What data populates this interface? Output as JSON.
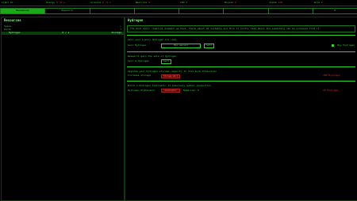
{
  "status": [
    {
      "label": "Light On",
      "value": ""
    },
    {
      "label": "Energy",
      "value": "0 /0 s"
    },
    {
      "label": "Uranium",
      "value": "0 /0 s"
    },
    {
      "label": "Neutrons",
      "value": "0"
    },
    {
      "label": "CPU",
      "value": "0"
    },
    {
      "label": "Monies",
      "value": "0"
    },
    {
      "label": "Alpha",
      "value": "128"
    },
    {
      "label": "Gold",
      "value": "0"
    }
  ],
  "tabs": [
    {
      "label": "Resources",
      "active": true
    },
    {
      "label": "Research",
      "active": false
    },
    {
      "label": "",
      "active": false
    },
    {
      "label": "",
      "active": false
    },
    {
      "label": "",
      "active": false
    },
    {
      "label": "",
      "active": false
    },
    {
      "label": "",
      "active": false
    },
    {
      "label": "R",
      "active": false
    }
  ],
  "left": {
    "title": "Resources",
    "tree": [
      {
        "label": "Space",
        "toggle": "▸",
        "level": 0,
        "selected": false
      },
      {
        "label": "Earth",
        "toggle": "▾",
        "level": 0,
        "selected": false
      },
      {
        "label": "Hydrogen",
        "toggle": "0 / s",
        "extra": "Storage",
        "level": 1,
        "selected": true
      }
    ]
  },
  "right": {
    "title": "Hydrogen",
    "description": "The most basic chemical element we have, there about as unstable and this is pretty lead about the something can be produced from it.",
    "sell_section": {
      "heading": "Sell your lovely Hydrogen for cash",
      "label": "Sell Hydrogen",
      "input_placeholder": "Max amount",
      "button": "Sell",
      "auto_label": "Buy Hydrogen"
    },
    "storage_section": {
      "heading": "Research gain the sale of Hydrogen",
      "label": "Sell & Hydrogen",
      "button": "Sell"
    },
    "upgrade_section": {
      "heading": "Upgrade your Hydrogen storage capacity to hold more Production",
      "label": "Increase storage",
      "bar_text": "Storage Unit",
      "cost": "100 Hydrogen"
    },
    "generator_section": {
      "heading": "Build a Hydrogen Siphonator to passively gather production",
      "label": "Hydrogen Siphonator",
      "bar_text": "Siphonator",
      "owned": "Numerous: 0",
      "cost": "10 Hydrogen"
    }
  },
  "colors": {
    "accent": "#2fd62f",
    "active_tab": "#19a919",
    "warning": "#e03030"
  }
}
